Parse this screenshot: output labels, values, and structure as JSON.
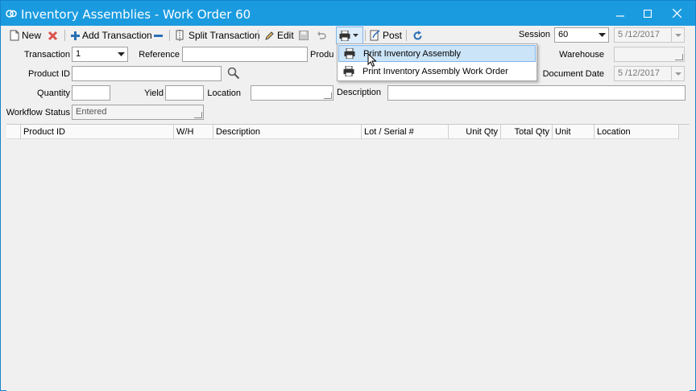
{
  "window": {
    "title": "Inventory Assemblies - Work Order 60",
    "accent_color": "#1a9be0"
  },
  "toolbar": {
    "new_label": "New",
    "add_transaction_label": "Add Transaction",
    "split_transaction_label": "Split Transaction",
    "edit_label": "Edit",
    "post_label": "Post",
    "session_label": "Session",
    "session_value": "60",
    "session_date": "5 /12/2017"
  },
  "form": {
    "transaction_label": "Transaction",
    "transaction_value": "1",
    "reference_label": "Reference",
    "reference_value": "",
    "product_partial_label": "Produ",
    "warehouse_label": "Warehouse",
    "warehouse_value": "",
    "product_id_label": "Product ID",
    "product_id_value": "",
    "document_date_label": "Document Date",
    "document_date_value": "5 /12/2017",
    "quantity_label": "Quantity",
    "quantity_value": "",
    "yield_label": "Yield",
    "yield_value": "",
    "location_label": "Location",
    "location_value": "",
    "description_label": "Description",
    "description_value": "",
    "workflow_status_label": "Workflow Status",
    "workflow_status_value": "Entered"
  },
  "grid": {
    "columns": [
      "Product ID",
      "W/H",
      "Description",
      "Lot / Serial #",
      "Unit Qty",
      "Total Qty",
      "Unit",
      "Location"
    ]
  },
  "print_menu": {
    "items": [
      {
        "label": "Print Inventory Assembly",
        "highlighted": true
      },
      {
        "label": "Print Inventory Assembly Work Order",
        "highlighted": false
      }
    ]
  },
  "icons": {
    "app": "app-logo-icon",
    "new": "new-document-icon",
    "delete": "delete-x-icon",
    "add": "plus-icon",
    "remove": "minus-icon",
    "split": "split-icon",
    "edit": "pencil-icon",
    "save": "save-disk-icon",
    "undo": "undo-icon",
    "print": "printer-icon",
    "post": "post-icon",
    "refresh": "refresh-icon",
    "search": "magnifier-icon"
  }
}
